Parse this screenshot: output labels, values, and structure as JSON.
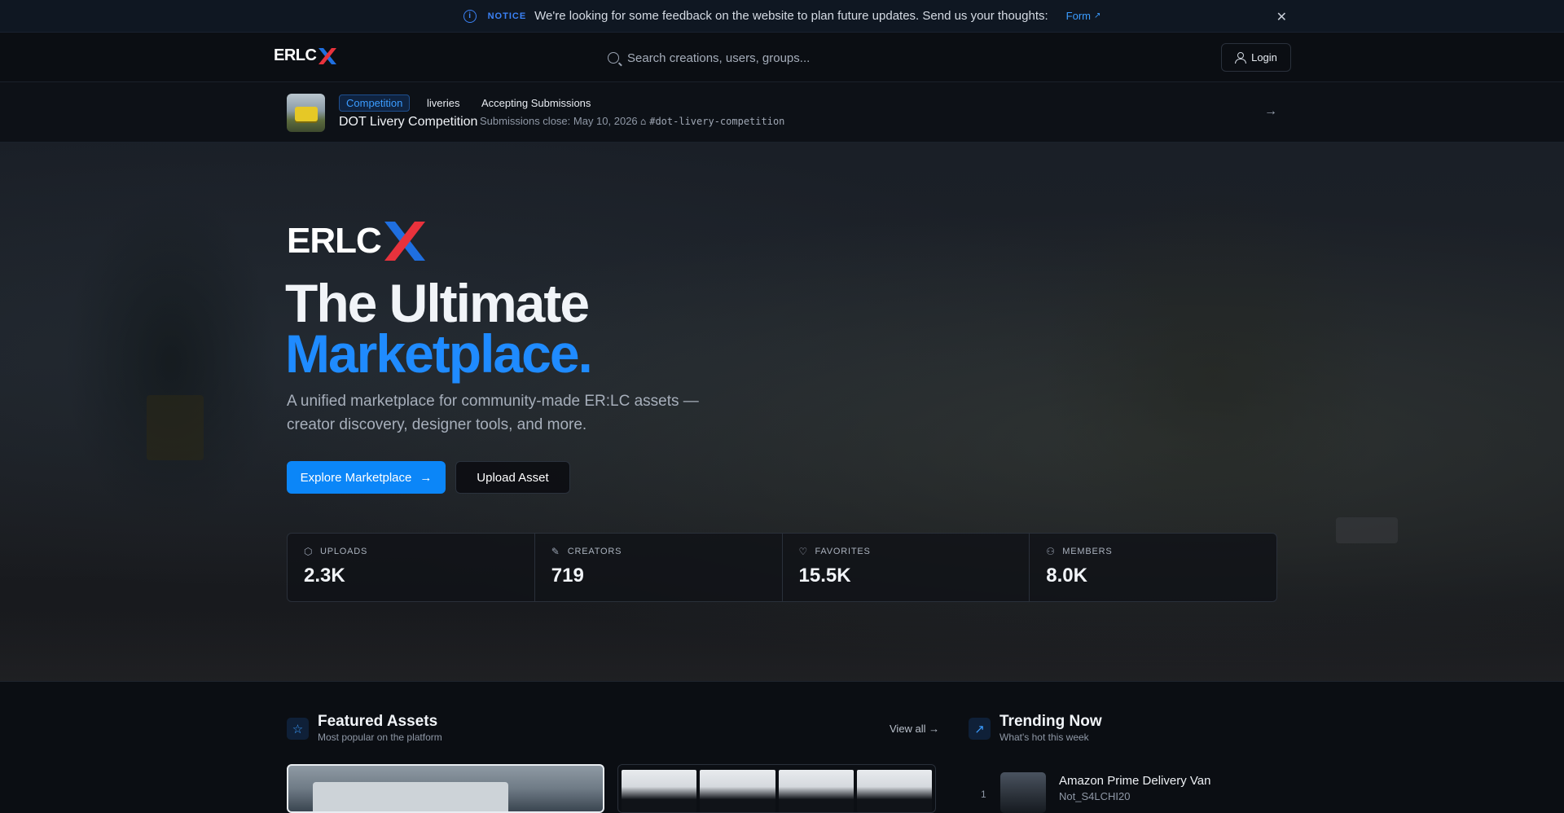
{
  "notice": {
    "tag": "NOTICE",
    "message": "We're looking for some feedback on the website to plan future updates. Send us your thoughts:",
    "link_label": "Form"
  },
  "header": {
    "logo_text": "ERLC",
    "logo_mark": "X",
    "search_placeholder": "Search creations, users, groups...",
    "login_label": "Login"
  },
  "competition": {
    "badge": "Competition",
    "category": "liveries",
    "status": "Accepting Submissions",
    "title": "DOT Livery Competition",
    "closes": "Submissions close: May 10, 2026",
    "hashtag": "#dot-livery-competition"
  },
  "hero": {
    "logo_text": "ERLC",
    "logo_mark": "X",
    "headline_1": "The Ultimate",
    "headline_2": "Marketplace",
    "headline_dot": ".",
    "subtitle": "A unified marketplace for community-made ER:LC assets — creator discovery, designer tools, and more.",
    "primary_button": "Explore Marketplace",
    "secondary_button": "Upload Asset"
  },
  "stats": [
    {
      "label": "UPLOADS",
      "value": "2.3K",
      "icon": "box-icon"
    },
    {
      "label": "CREATORS",
      "value": "719",
      "icon": "brush-icon"
    },
    {
      "label": "FAVORITES",
      "value": "15.5K",
      "icon": "heart-icon"
    },
    {
      "label": "MEMBERS",
      "value": "8.0K",
      "icon": "users-icon"
    }
  ],
  "featured": {
    "title": "Featured Assets",
    "subtitle": "Most popular on the platform",
    "view_all": "View all →"
  },
  "trending": {
    "title": "Trending Now",
    "subtitle": "What's hot this week",
    "items": [
      {
        "rank": "1",
        "name": "Amazon Prime Delivery Van",
        "author": "Not_S4LCHI20"
      }
    ]
  },
  "colors": {
    "accent": "#0b86f8",
    "logo_red": "#e8323c",
    "logo_blue": "#1f6fe0",
    "background": "#0b0e13"
  }
}
